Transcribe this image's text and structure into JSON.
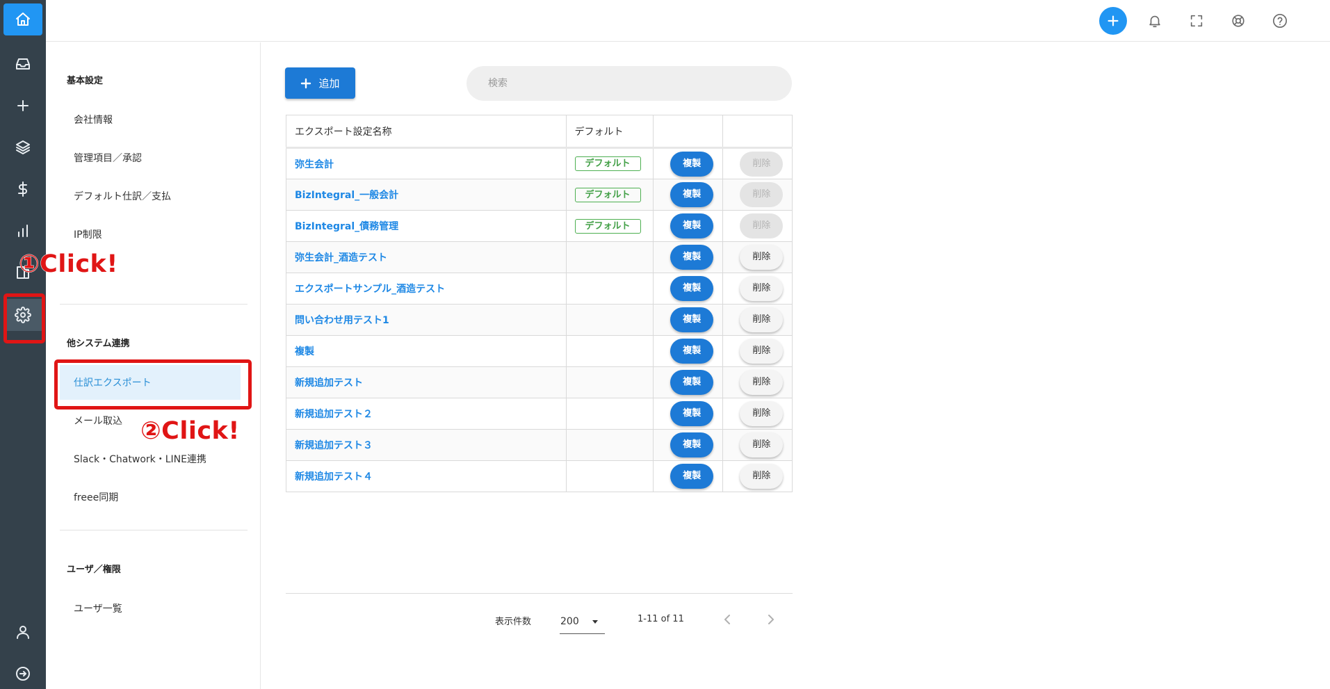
{
  "topbar": {
    "icons": [
      "plus-icon",
      "bell-icon",
      "fullscreen-icon",
      "lifebuoy-icon",
      "help-icon"
    ]
  },
  "rail": {
    "icons": [
      "home-icon",
      "inbox-icon",
      "plus-icon",
      "layers-icon",
      "dollar-icon",
      "chart-icon",
      "book-icon",
      "gear-icon",
      "user-icon",
      "arrow-right-circle-icon"
    ]
  },
  "annotations": {
    "click1": "①Click!",
    "click2": "②Click!",
    "highlight_color": "#e01515"
  },
  "menu": {
    "sections": [
      {
        "heading": "基本設定",
        "items": [
          "会社情報",
          "管理項目／承認",
          "デフォルト仕訳／支払",
          "IP制限"
        ]
      },
      {
        "heading": "他システム連携",
        "items": [
          "仕訳エクスポート",
          "メール取込",
          "Slack・Chatwork・LINE連携",
          "freee同期"
        ]
      },
      {
        "heading": "ユーザ／権限",
        "items": [
          "ユーザ一覧"
        ]
      }
    ],
    "active_item": "仕訳エクスポート"
  },
  "main": {
    "add_label": "追加",
    "search_placeholder": "検索",
    "table": {
      "headers": [
        "エクスポート設定名称",
        "デフォルト",
        "",
        ""
      ],
      "copy_label": "複製",
      "delete_label": "削除",
      "default_label": "デフォルト",
      "rows": [
        {
          "name": "弥生会計",
          "default": true
        },
        {
          "name": "BizIntegral_一般会計",
          "default": true
        },
        {
          "name": "BizIntegral_債務管理",
          "default": true
        },
        {
          "name": "弥生会計_酒造テスト",
          "default": false
        },
        {
          "name": "エクスポートサンプル_酒造テスト",
          "default": false
        },
        {
          "name": "問い合わせ用テスト1",
          "default": false
        },
        {
          "name": "複製",
          "default": false
        },
        {
          "name": "新規追加テスト",
          "default": false
        },
        {
          "name": "新規追加テスト２",
          "default": false
        },
        {
          "name": "新規追加テスト３",
          "default": false
        },
        {
          "name": "新規追加テスト４",
          "default": false
        }
      ]
    },
    "pager": {
      "rows_label": "表示件数",
      "rows_value": "200",
      "range": "1-11 of 11"
    }
  },
  "colors": {
    "accent": "#1d7ad6",
    "link": "#1e88e5",
    "rail_bg": "#34414b",
    "default_badge": "#43a047"
  }
}
